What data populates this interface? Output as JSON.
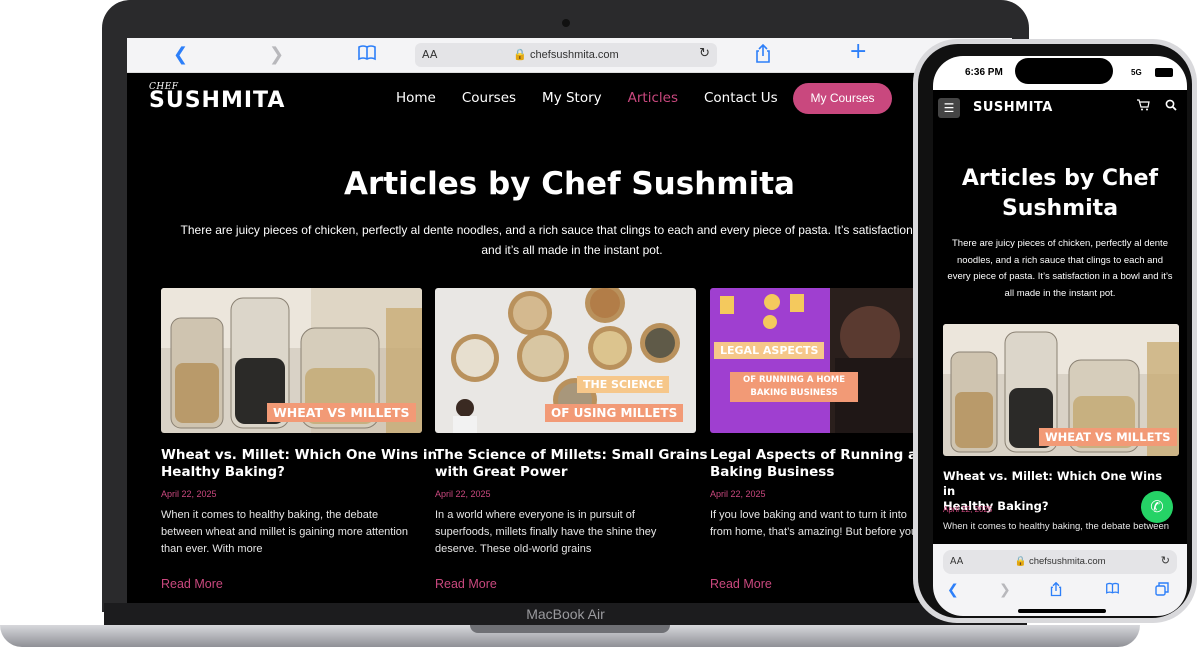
{
  "laptop": {
    "device_label": "MacBook Air",
    "browser": {
      "aa_label": "AA",
      "url": "chefsushmita.com"
    },
    "site": {
      "brand_prefix": "CHEF",
      "brand_name": "SUSHMITA",
      "nav": [
        {
          "label": "Home"
        },
        {
          "label": "Courses"
        },
        {
          "label": "My Story"
        },
        {
          "label": "Articles"
        },
        {
          "label": "Contact Us"
        }
      ],
      "active_nav": "Articles",
      "cta_label": "My Courses",
      "page_title": "Articles by Chef Sushmita",
      "intro_line1": "There are juicy pieces of chicken, perfectly al dente noodles, and a rich sauce that clings to each and every piece of pasta. It’s satisfaction in a bowl",
      "intro_line2": "and it’s all made in the instant pot.",
      "articles": [
        {
          "image_text": "WHEAT VS MILLETS",
          "title_line1": "Wheat vs. Millet: Which One Wins in",
          "title_line2": "Healthy Baking?",
          "date": "April 22, 2025",
          "excerpt_lines": [
            "When it comes to healthy baking, the debate",
            "between wheat and millet is gaining more attention",
            "than ever. With more"
          ],
          "link": "Read More"
        },
        {
          "image_text_1": "THE SCIENCE",
          "image_text_2": "OF USING MILLETS",
          "title_line1": "The Science of Millets: Small Grains",
          "title_line2": "with Great Power",
          "date": "April 22, 2025",
          "excerpt_lines": [
            "In a world where everyone is in pursuit of",
            "superfoods, millets finally have the shine they",
            "deserve. These old-world grains"
          ],
          "link": "Read More"
        },
        {
          "image_text_1": "LEGAL ASPECTS",
          "image_text_2": "OF RUNNING A HOME BAKING BUSINESS",
          "title_line1": "Legal Aspects of Running a Home",
          "title_line2": "Baking Business",
          "date": "April 22, 2025",
          "excerpt_lines": [
            "If you love baking and want to turn it into",
            "from home, that’s amazing! But before you",
            ""
          ],
          "link": "Read More"
        }
      ]
    }
  },
  "phone": {
    "status": {
      "time": "6:36 PM",
      "network": "5G"
    },
    "brand_name": "SUSHMITA",
    "page_title_line1": "Articles by Chef",
    "page_title_line2": "Sushmita",
    "intro_lines": [
      "There are juicy pieces of chicken, perfectly al dente",
      "noodles, and a rich sauce that clings to each and",
      "every piece of pasta. It’s satisfaction in a bowl and it’s",
      "all made in the instant pot."
    ],
    "article": {
      "image_text": "WHEAT VS MILLETS",
      "title_line1": "Wheat vs. Millet: Which One Wins in",
      "title_line2": "Healthy Baking?",
      "date": "April 22, 2025",
      "excerpt": "When it comes to healthy baking, the debate between"
    },
    "browser": {
      "aa_label": "AA",
      "url": "chefsushmita.com"
    }
  },
  "icons": {
    "back": "chevron-left-icon",
    "forward": "chevron-right-icon",
    "bookmarks": "book-icon",
    "share": "share-icon",
    "new_tab": "plus-icon",
    "reload": "reload-icon",
    "lock": "lock-icon",
    "menu": "hamburger-menu-icon",
    "cart": "cart-icon",
    "search": "search-icon",
    "chat": "whatsapp-icon",
    "tabs": "tabs-icon"
  },
  "colors": {
    "accent": "#c9487e",
    "background": "#000000",
    "safari_blue": "#2d7ff9"
  }
}
